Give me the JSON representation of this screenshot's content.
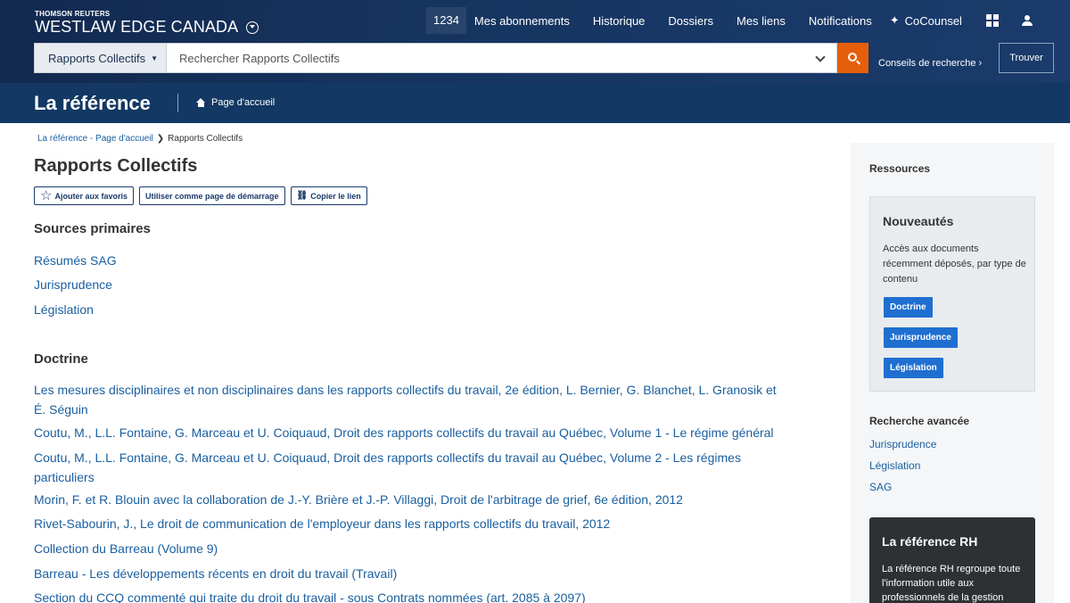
{
  "header": {
    "brand_small": "THOMSON REUTERS",
    "brand_name": "WESTLAW EDGE CANADA",
    "client_id": "1234",
    "nav": [
      "Mes abonnements",
      "Historique",
      "Dossiers",
      "Mes liens",
      "Notifications"
    ],
    "cocounsel_label": "CoCounsel",
    "icons": {
      "cocounsel": "sparkle-icon",
      "apps": "grid-icon",
      "user": "user-icon"
    }
  },
  "search": {
    "scope_label": "Rapports Collectifs",
    "placeholder": "Rechercher Rapports Collectifs",
    "tips_label": "Conseils de recherche ›",
    "find_label": "Trouver"
  },
  "band": {
    "title": "La référence",
    "home_label": "Page d'accueil"
  },
  "breadcrumb": {
    "parent": "La référence - Page d'accueil",
    "current": "Rapports Collectifs"
  },
  "page": {
    "title": "Rapports Collectifs",
    "actions": {
      "favorite": "Ajouter aux favoris",
      "start_page": "Utiliser comme page de démarrage",
      "copy_link": "Copier le lien"
    }
  },
  "sections": {
    "primary_title": "Sources primaires",
    "primary_links": [
      "Résumés SAG",
      "Jurisprudence",
      "Législation"
    ],
    "doctrine_title": "Doctrine",
    "doctrine_links": [
      {
        "l1": "Les mesures disciplinaires et non disciplinaires dans les rapports collectifs du travail, 2e édition, L. Bernier, G. Blanchet, L. Granosik et",
        "l2": "É. Séguin"
      },
      {
        "l1": "Coutu, M., L.L. Fontaine, G. Marceau et U. Coiquaud, Droit des rapports collectifs du travail au Québec, Volume 1 - Le régime général",
        "l2": ""
      },
      {
        "l1": "Coutu, M., L.L. Fontaine, G. Marceau et U. Coiquaud, Droit des rapports collectifs du travail au Québec, Volume 2 - Les régimes",
        "l2": "particuliers"
      },
      {
        "l1": "Morin, F. et R. Blouin avec la collaboration de J.-Y. Brière et J.-P. Villaggi, Droit de l'arbitrage de grief, 6e édition, 2012",
        "l2": ""
      },
      {
        "l1": "Rivet-Sabourin, J., Le droit de communication de l'employeur dans les rapports collectifs du travail, 2012",
        "l2": ""
      },
      {
        "l1": "Collection du Barreau (Volume 9)",
        "l2": ""
      },
      {
        "l1": "Barreau - Les développements récents en droit du travail (Travail)",
        "l2": ""
      },
      {
        "l1": "Section du CCQ commenté qui traite du droit du travail - sous Contrats nommées (art. 2085 à 2097)",
        "l2": ""
      }
    ]
  },
  "sidebar": {
    "resources_title": "Ressources",
    "news_box": {
      "title": "Nouveautés",
      "desc": "Accès aux documents récemment déposés, par type de contenu",
      "buttons": [
        "Doctrine",
        "Jurisprudence",
        "Législation"
      ]
    },
    "advanced": {
      "title": "Recherche avancée",
      "links": [
        "Jurisprudence",
        "Législation",
        "SAG"
      ]
    },
    "rh_box": {
      "title": "La référence RH",
      "desc_lines": [
        "La référence RH regroupe toute",
        "l'information utile aux",
        "professionnels de la gestion"
      ]
    }
  }
}
